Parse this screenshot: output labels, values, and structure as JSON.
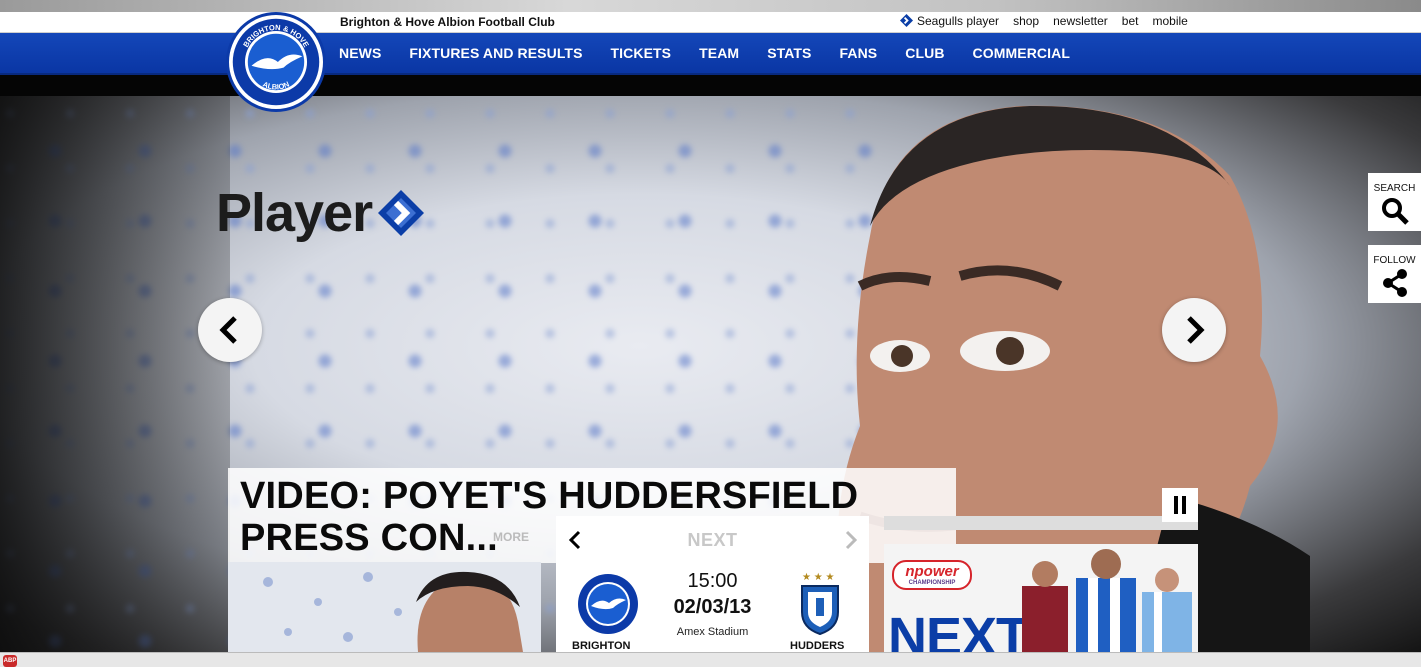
{
  "header": {
    "club_name": "Brighton & Hove Albion Football Club",
    "util_links": [
      "Seagulls player",
      "shop",
      "newsletter",
      "bet",
      "mobile"
    ]
  },
  "crest": {
    "top_text": "BRIGHTON & HOVE",
    "bottom_text": "ALBION"
  },
  "nav": {
    "items": [
      "NEWS",
      "FIXTURES AND RESULTS",
      "TICKETS",
      "TEAM",
      "STATS",
      "FANS",
      "CLUB",
      "COMMERCIAL"
    ]
  },
  "hero": {
    "brand_label": "Player",
    "headline": "VIDEO: POYET'S HUDDERSFIELD PRESS CON...",
    "more_label": "MORE"
  },
  "side_tabs": {
    "search_label": "SEARCH",
    "follow_label": "FOLLOW"
  },
  "match": {
    "next_label": "NEXT",
    "kickoff_time": "15:00",
    "date": "02/03/13",
    "venue": "Amex Stadium",
    "home_team": "BRIGHTON",
    "away_team": "HUDDERS",
    "away_stars": "★ ★ ★"
  },
  "promo": {
    "brand": "npower",
    "brand_sub": "CHAMPIONSHIP",
    "text": "NEXT"
  },
  "statusbar": {
    "adblock_label": "ABP"
  },
  "colors": {
    "brand_blue": "#0a36a4",
    "nav_text": "#ffffff"
  }
}
